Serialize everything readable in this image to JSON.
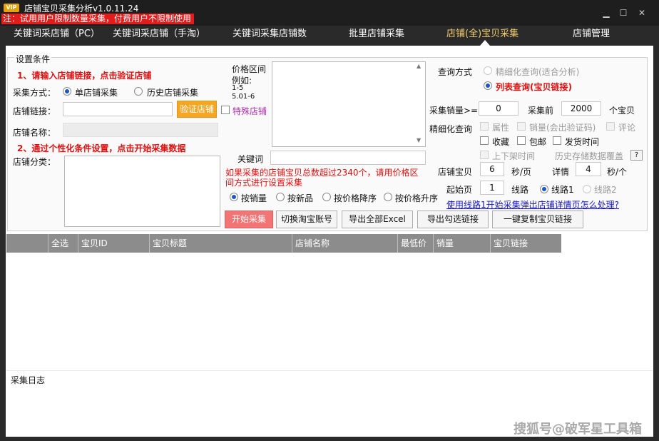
{
  "app": {
    "badge": "VIP",
    "title": "店铺宝贝采集分析v1.0.11.24",
    "notice": "注：试用用户限制数量采集，付费用户不限制使用",
    "window_controls": {
      "minimize": "▁",
      "maximize": "☐",
      "close": "✕"
    }
  },
  "nav": {
    "tabs": [
      {
        "label": "关键词采店铺（PC）"
      },
      {
        "label": "关键词采店铺（手淘）"
      },
      {
        "label": "关键词采集店铺数"
      },
      {
        "label": "批里店铺采集"
      },
      {
        "label": "店铺(全)宝贝采集"
      },
      {
        "label": "店铺管理"
      }
    ],
    "active_index": 4
  },
  "settings": {
    "legend": "设置条件",
    "step1": "1、请输入店铺链接，点击验证店铺",
    "collect_mode_label": "采集方式：",
    "mode_single": "单店铺采集",
    "mode_history": "历史店铺采集",
    "shop_link_label": "店铺链接：",
    "shop_link_value": "",
    "verify_button": "验证店铺",
    "special_shop": "特殊店铺",
    "shop_name_label": "店铺名称：",
    "shop_name_value": "",
    "step2": "2、通过个性化条件设置，点击开始采集数据",
    "category_label": "店铺分类：",
    "price_range_label": "价格区间",
    "price_example": "例如:",
    "price_example_1": "1-5",
    "price_example_2": "5.01-6",
    "keyword_label": "关键词",
    "keyword_value": "",
    "warning": "如果采集的店铺宝贝总数超过2340个，请用价格区间方式进行设置采集",
    "sort_sales": "按销量",
    "sort_new": "按新品",
    "sort_price_desc": "按价格降序",
    "sort_price_asc": "按价格升序",
    "start_button": "开始采集",
    "switch_account_button": "切换淘宝账号",
    "export_all_button": "导出全部Excel",
    "export_checked_button": "导出勾选链接",
    "copy_links_button": "一键复制宝贝链接",
    "query_mode_label": "查询方式",
    "query_fine": "精细化查询(适合分析)",
    "query_list": "列表查询(宝贝链接)",
    "sales_gte_label": "采集销量>=",
    "sales_gte_value": "0",
    "collect_top_label": "采集前",
    "collect_top_value": "2000",
    "items_unit": "个宝贝",
    "fine_query_label": "精细化查询",
    "opt_attr": "属性",
    "opt_sales_captcha": "销量(会出验证码)",
    "opt_comment": "评论",
    "opt_favorite": "收藏",
    "opt_freeship": "包邮",
    "opt_shiptime": "发货时间",
    "opt_listing_time": "上下架时间",
    "history_cover": "历史存储数据覆盖",
    "help_button": "?",
    "shop_item_label": "店铺宝贝",
    "shop_item_value": "6",
    "per_page_unit": "秒/页",
    "detail_label": "详情",
    "detail_value": "4",
    "per_item_unit": "秒/个",
    "start_page_label": "起始页",
    "start_page_value": "1",
    "route_label": "线路",
    "route_1": "线路1",
    "route_2": "线路2",
    "help_link": "使用线路1开始采集弹出店铺详情页怎么处理?"
  },
  "table": {
    "headers": [
      "",
      "全选",
      "宝贝ID",
      "宝贝标题",
      "店铺名称",
      "最低价",
      "销量",
      "宝贝链接"
    ],
    "rows": []
  },
  "log": {
    "title": "采集日志"
  },
  "watermark": "搜狐号@破军星工具箱",
  "colors": {
    "accent_orange": "#f5a623",
    "start_pink": "#f27474",
    "notice_red": "#e21b1b",
    "active_tab": "#f4ce6f",
    "link_blue": "#1515d0"
  }
}
